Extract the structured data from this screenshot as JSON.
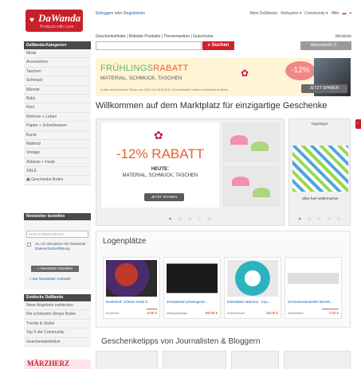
{
  "header": {
    "logo_text": "DaWanda",
    "logo_tagline": "Products with Love",
    "login": "Einloggen",
    "or": "oder",
    "register": "Registrieren",
    "usernav": [
      "Mein DaWanda",
      "Verkaufen ▾",
      "Community ▾",
      "Hilfe",
      "▾"
    ],
    "catlinks": "Geschenkefinder | Beliebte Produkte | Themenwelten | Gutscheine",
    "merkliste": "Merkliste",
    "search_placeholder": "",
    "search_button": "Suchen",
    "cart": "Warenkorb: 0"
  },
  "sidebar": {
    "heading": "DaWanda-Kategorien",
    "items": [
      "Mode",
      "Accessoires",
      "Taschen",
      "Schmuck",
      "Männer",
      "Baby",
      "Kind",
      "Wohnen + Leben",
      "Papier + Schreibwaren",
      "Kunst",
      "Material",
      "Vintage",
      "Anlässe + Feste",
      "SALE",
      "Geschenke finden"
    ]
  },
  "newsletter": {
    "heading": "Newsletter bestellen",
    "email_placeholder": "Deine E-Mail-Adresse",
    "consent_text": "Ja, ich akzeptiere die DaWanda",
    "consent_link": "Datenschutzerklärung",
    "subscribe": "» Newsletter bestellen",
    "archive": "» Zur Newsletter-Auswahl"
  },
  "discover": {
    "heading": "Entdecke DaWanda",
    "items": [
      "Neue Angebote entdecken",
      "Die schönsten Shops finden",
      "Trends & Styles",
      "Top 5 der Community",
      "Geschenkdetektive"
    ]
  },
  "marz_label": "MÄRZHERZ",
  "banner": {
    "title_a": "FRÜHLINGS",
    "title_b": "RABATT",
    "subtitle": "MATERIAL, SCHMUCK, TASCHEN",
    "fine": "In allen teilnehmenden Shops vom 18.03. bis 28.03.2011. Versandkosten bleiben unverändert bestehen.",
    "badge": "-12%",
    "cta": "JETZT SPAREN"
  },
  "welcome": "Willkommen auf dem Marktplatz für einzigartige Geschenke",
  "hero": {
    "pct": "-12% RABATT",
    "line1": "HEUTE:",
    "line2": "MATERIAL, SCHMUCK, TASCHEN",
    "cta": "JETZT SPAREN",
    "dots": "● ○ ○ ○ ○"
  },
  "tips": {
    "heading": "Tagestipps",
    "caption": "alles-fuer-sellermacher",
    "dots": "● ○ ○ ○ ○"
  },
  "logen": {
    "heading": "Logenplätze",
    "cards": [
      {
        "name": "Dunkelrot\" schöne Kette k...",
        "shop": "dunkelrot",
        "old": "10.00 €",
        "price": "3.00 €"
      },
      {
        "name": "Jerseykleid schwingend...",
        "shop": "lieblingsdesign",
        "old": "",
        "price": "80.00 €"
      },
      {
        "name": "funkelalien Mamma - trop...",
        "shop": "Kreisverkehr",
        "old": "",
        "price": "16.00 €"
      },
      {
        "name": "Schmusesweatshirt Bezirk...",
        "shop": "Silberdistel",
        "old": "7.22 € Grun",
        "price": "7.22 €"
      }
    ]
  },
  "journalists": "Geschenketipps von Journalisten & Bloggern",
  "colors": {
    "brand": "#c8202a",
    "accent": "#e8612c",
    "green": "#5cb85c",
    "link": "#1a5fa8"
  }
}
